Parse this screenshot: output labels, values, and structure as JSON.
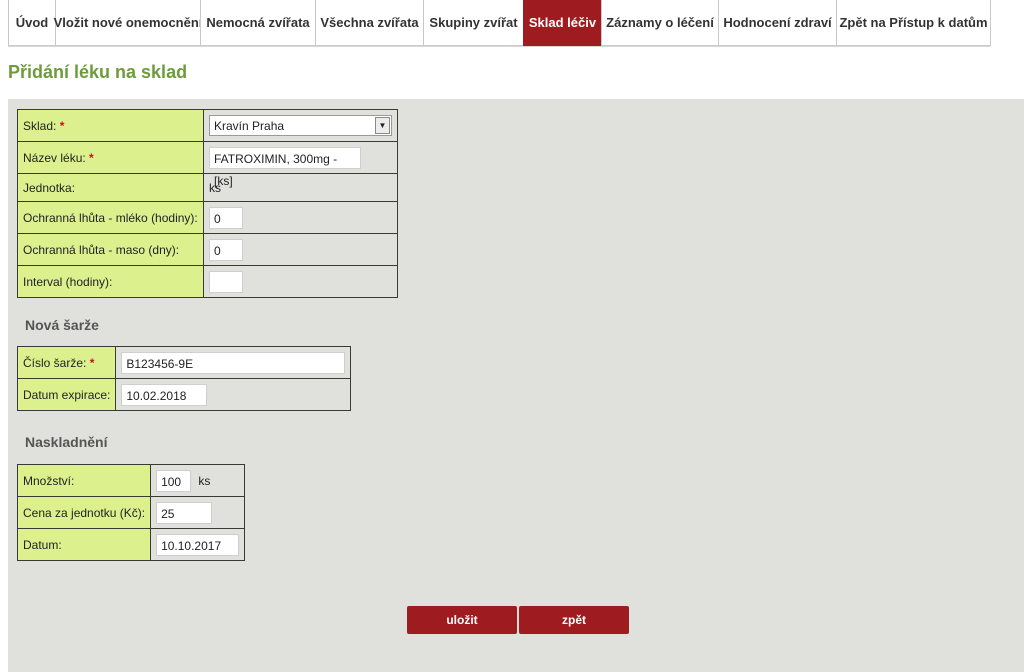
{
  "tabs": [
    {
      "label": "Úvod"
    },
    {
      "label": "Vložit nové onemocnění"
    },
    {
      "label": "Nemocná zvířata"
    },
    {
      "label": "Všechna zvířata"
    },
    {
      "label": "Skupiny zvířat"
    },
    {
      "label": "Sklad léčiv"
    },
    {
      "label": "Záznamy o léčení"
    },
    {
      "label": "Hodnocení zdraví"
    },
    {
      "label": "Zpět na Přístup k datům"
    }
  ],
  "active_tab": "Sklad léčiv",
  "page_title": "Přidání léku na sklad",
  "required_mark": "*",
  "drug_form": {
    "warehouse_label": "Sklad:",
    "warehouse_value": "Kravín Praha",
    "drug_name_label": "Název léku:",
    "drug_name_value": "FATROXIMIN, 300mg - [ks]",
    "unit_label": "Jednotka:",
    "unit_value": "ks",
    "milk_label": "Ochranná lhůta - mléko (hodiny):",
    "milk_value": "0",
    "meat_label": "Ochranná lhůta - maso (dny):",
    "meat_value": "0",
    "interval_label": "Interval (hodiny):",
    "interval_value": ""
  },
  "batch_section": {
    "title": "Nová šarže",
    "batch_number_label": "Číslo šarže:",
    "batch_number_value": "B123456-9E",
    "expiry_label": "Datum expirace:",
    "expiry_value": "10.02.2018"
  },
  "stock_section": {
    "title": "Naskladnění",
    "quantity_label": "Množství:",
    "quantity_value": "100",
    "quantity_unit": "ks",
    "unit_price_label": "Cena za jednotku (Kč):",
    "unit_price_value": "25",
    "date_label": "Datum:",
    "date_value": "10.10.2017"
  },
  "buttons": {
    "save": "uložit",
    "back": "zpět"
  },
  "colors": {
    "accent": "#9e1c20",
    "label_bg": "#dcf18e",
    "panel_bg": "#e0e0dc",
    "title_green": "#6e9b3c",
    "required": "#c0141a"
  }
}
